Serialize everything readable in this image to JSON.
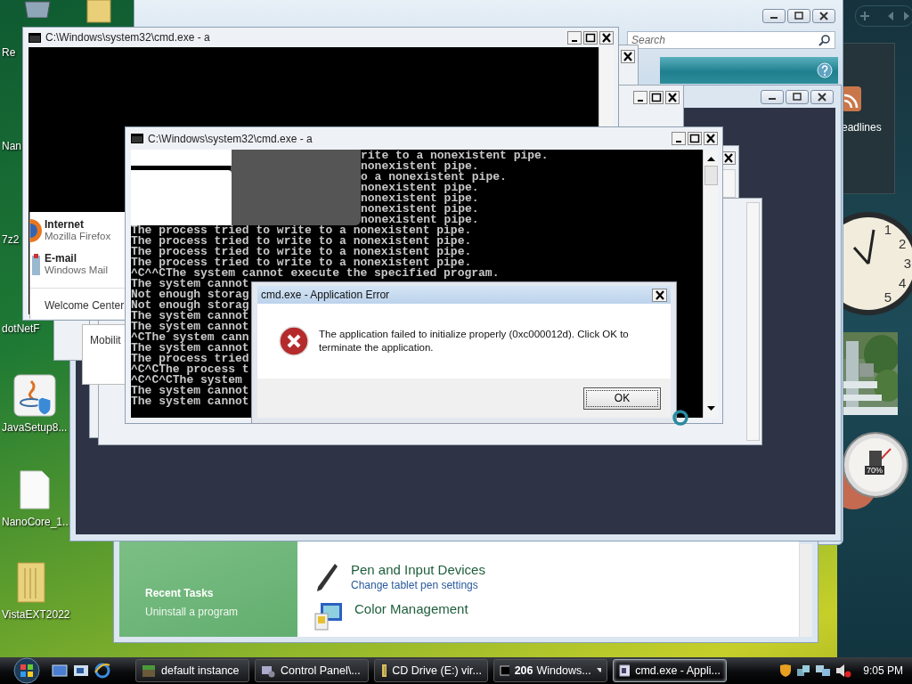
{
  "desktop_icons": [
    {
      "label": "Re",
      "kind": "none"
    },
    {
      "label": "Nan",
      "kind": "none"
    },
    {
      "label": "7z2",
      "kind": "none"
    },
    {
      "label": "dotNetF",
      "kind": "none"
    },
    {
      "label": "JavaSetup8...",
      "kind": "installer"
    },
    {
      "label": "NanoCore_1...",
      "kind": "document"
    },
    {
      "label": "VistaEXT2022",
      "kind": "folder"
    }
  ],
  "control_panel": {
    "search": {
      "placeholder": "Search"
    },
    "recent_tasks": {
      "title": "Recent Tasks",
      "items": [
        "Uninstall a program"
      ]
    },
    "categories": [
      {
        "kind": "pen",
        "title": "Pen and Input Devices",
        "link": "Change tablet pen settings"
      },
      {
        "kind": "color",
        "title": "Color Management"
      }
    ]
  },
  "console_back": {
    "title": "C:\\Windows\\system32\\cmd.exe - a"
  },
  "start_menu": {
    "pinned": [
      {
        "kind": "browser",
        "title": "Internet",
        "subtitle": "Mozilla Firefox"
      },
      {
        "kind": "mail",
        "title": "E-mail",
        "subtitle": "Windows Mail"
      }
    ],
    "items": [
      "Welcome Center"
    ]
  },
  "menu_fragment": {
    "items": [
      "Mobilit"
    ]
  },
  "console_window": {
    "title": "C:\\Windows\\system32\\cmd.exe - a",
    "lines": [
      {
        "kind": "tail",
        "text": "rite to a nonexistent pipe."
      },
      {
        "kind": "tail",
        "text": "nonexistent pipe."
      },
      {
        "kind": "tail",
        "text": "o a nonexistent pipe."
      },
      {
        "kind": "tail",
        "text": "nonexistent pipe."
      },
      {
        "kind": "tail",
        "text": "nonexistent pipe."
      },
      {
        "kind": "tail",
        "text": "nonexistent pipe."
      },
      {
        "kind": "tail",
        "text": "nonexistent pipe."
      },
      {
        "kind": "full",
        "text": "The process tried to write to a nonexistent pipe."
      },
      {
        "kind": "full",
        "text": "The process tried to write to a nonexistent pipe."
      },
      {
        "kind": "full",
        "text": "The process tried to write to a nonexistent pipe."
      },
      {
        "kind": "full",
        "text": "The process tried to write to a nonexistent pipe."
      },
      {
        "kind": "full",
        "text": "^C^^CThe system cannot execute the specified program."
      },
      {
        "kind": "full",
        "text": "The system cannot"
      },
      {
        "kind": "full",
        "text": "Not enough storag"
      },
      {
        "kind": "full",
        "text": "Not enough storag"
      },
      {
        "kind": "full",
        "text": "The system cannot"
      },
      {
        "kind": "full",
        "text": "The system cannot"
      },
      {
        "kind": "full",
        "text": "^CThe system cann"
      },
      {
        "kind": "full",
        "text": "The system cannot"
      },
      {
        "kind": "full",
        "text": "The process tried"
      },
      {
        "kind": "full",
        "text": "^C^CThe process t"
      },
      {
        "kind": "full",
        "text": "^C^C^CThe system"
      },
      {
        "kind": "full",
        "text": "The system cannot"
      },
      {
        "kind": "full",
        "text": "The system cannot"
      }
    ]
  },
  "error_dialog": {
    "title": "cmd.exe - Application Error",
    "message": "The application failed to initialize properly (0xc000012d). Click OK to terminate the application.",
    "buttons": [
      "OK"
    ]
  },
  "sidebar": {
    "feed": {
      "label": "eadlines"
    },
    "clock": {
      "numerals": [
        "1",
        "2",
        "3",
        "4",
        "5"
      ]
    },
    "meter": {
      "reading": "70%"
    }
  },
  "taskbar": {
    "tasks": [
      {
        "kind": "game",
        "label": "default instance",
        "selected": false
      },
      {
        "kind": "control-panel",
        "label": "Control Panel\\...",
        "selected": false
      },
      {
        "kind": "folder",
        "label": "CD Drive (E:) vir...",
        "selected": false
      },
      {
        "kind": "console",
        "count": "206",
        "label": "Windows...",
        "selected": false
      },
      {
        "kind": "window",
        "label": "cmd.exe - Appli...",
        "selected": true
      }
    ],
    "clock": "9:05 PM"
  }
}
